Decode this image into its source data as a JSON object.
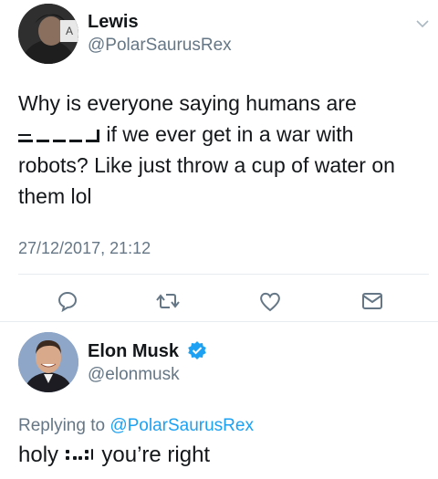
{
  "original_tweet": {
    "author": {
      "display_name": "Lewis",
      "handle": "@PolarSaurusRex"
    },
    "text_line_1": "Why is everyone saying humans are",
    "text_line_2_rest": "if we ever get in a war with",
    "text_line_3": "robots? Like just throw a cup of water on",
    "text_line_4": "them lol",
    "timestamp": "27/12/2017, 21:12",
    "menu_icon": "chevron-down-icon",
    "actions": [
      {
        "name": "reply",
        "icon": "reply-icon"
      },
      {
        "name": "retweet",
        "icon": "retweet-icon"
      },
      {
        "name": "like",
        "icon": "heart-icon"
      },
      {
        "name": "direct-message",
        "icon": "mail-icon"
      }
    ]
  },
  "reply_tweet": {
    "author": {
      "display_name": "Elon Musk",
      "handle": "@elonmusk",
      "verified": true
    },
    "replying_prefix": "Replying to",
    "replying_to": "@PolarSaurusRex",
    "text_start": "holy",
    "text_end": "you’re right"
  },
  "colors": {
    "text": "#14171a",
    "secondary": "#657786",
    "link": "#1da1f2",
    "divider": "#e6ecf0"
  }
}
